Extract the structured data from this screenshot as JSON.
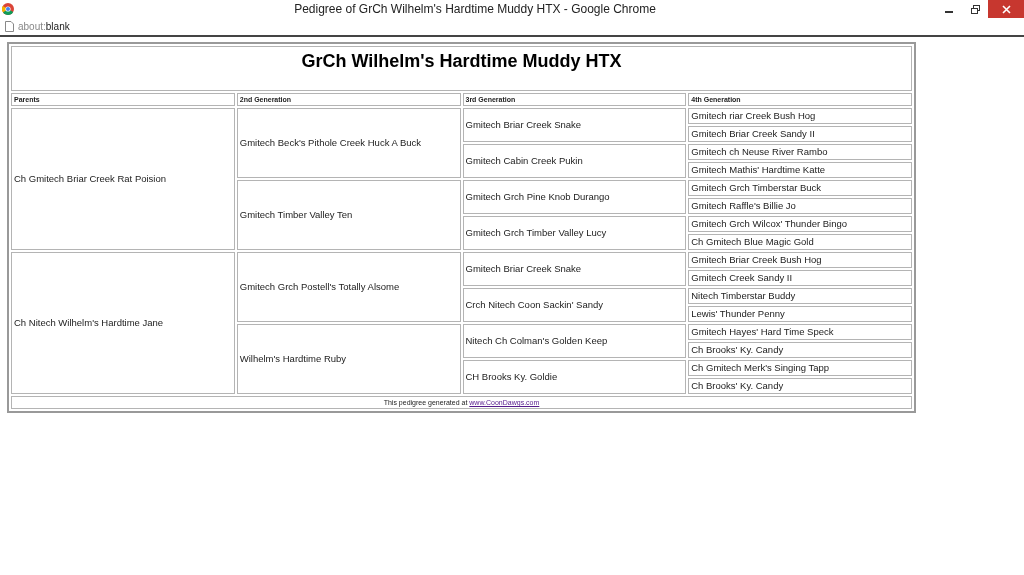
{
  "window": {
    "title": "Pedigree of GrCh Wilhelm's Hardtime Muddy HTX - Google Chrome"
  },
  "address_bar": {
    "scheme": "about:",
    "path": "blank"
  },
  "pedigree": {
    "title": "GrCh Wilhelm's Hardtime Muddy HTX",
    "columns": [
      "Parents",
      "2nd Generation",
      "3rd Generation",
      "4th Generation"
    ],
    "parents": [
      {
        "name": "Ch Gmitech Briar Creek Rat Poision",
        "children": [
          {
            "name": "Gmitech Beck's Pithole Creek Huck A Buck",
            "children": [
              {
                "name": "Gmitech Briar Creek Snake",
                "children": [
                  {
                    "name": "Gmitech riar Creek Bush Hog"
                  },
                  {
                    "name": "Gmitech Briar Creek Sandy II"
                  }
                ]
              },
              {
                "name": "Gmitech Cabin Creek Pukin",
                "children": [
                  {
                    "name": "Gmitech ch Neuse River Rambo"
                  },
                  {
                    "name": "Gmitech Mathis' Hardtime Katte"
                  }
                ]
              }
            ]
          },
          {
            "name": "Gmitech Timber Valley Ten",
            "children": [
              {
                "name": "Gmitech Grch Pine Knob Durango",
                "children": [
                  {
                    "name": "Gmitech Grch Timberstar Buck"
                  },
                  {
                    "name": "Gmitech Raffle's Billie Jo"
                  }
                ]
              },
              {
                "name": "Gmitech Grch Timber Valley Lucy",
                "children": [
                  {
                    "name": "Gmitech Grch Wilcox' Thunder Bingo"
                  },
                  {
                    "name": "Ch Gmitech Blue Magic Gold"
                  }
                ]
              }
            ]
          }
        ]
      },
      {
        "name": "Ch Nitech Wilhelm's Hardtime Jane",
        "children": [
          {
            "name": "Gmitech Grch Postell's Totally Alsome",
            "children": [
              {
                "name": "Gmitech Briar Creek Snake",
                "children": [
                  {
                    "name": "Gmitech Briar Creek Bush Hog"
                  },
                  {
                    "name": "Gmitech Creek Sandy II"
                  }
                ]
              },
              {
                "name": "Crch Nitech Coon Sackin' Sandy",
                "children": [
                  {
                    "name": "Nitech Timberstar Buddy"
                  },
                  {
                    "name": "Lewis' Thunder Penny"
                  }
                ]
              }
            ]
          },
          {
            "name": "Wilhelm's Hardtime Ruby",
            "children": [
              {
                "name": "Nitech Ch Colman's Golden Keep",
                "children": [
                  {
                    "name": "Gmitech Hayes' Hard Time Speck"
                  },
                  {
                    "name": "Ch Brooks' Ky. Candy"
                  }
                ]
              },
              {
                "name": "CH Brooks Ky. Goldie",
                "children": [
                  {
                    "name": "Ch Gmitech Merk's Singing Tapp"
                  },
                  {
                    "name": "Ch Brooks' Ky. Candy"
                  }
                ]
              }
            ]
          }
        ]
      }
    ],
    "footer": {
      "text": "This pedigree generated at",
      "link": "www.CoonDawgs.com"
    }
  }
}
